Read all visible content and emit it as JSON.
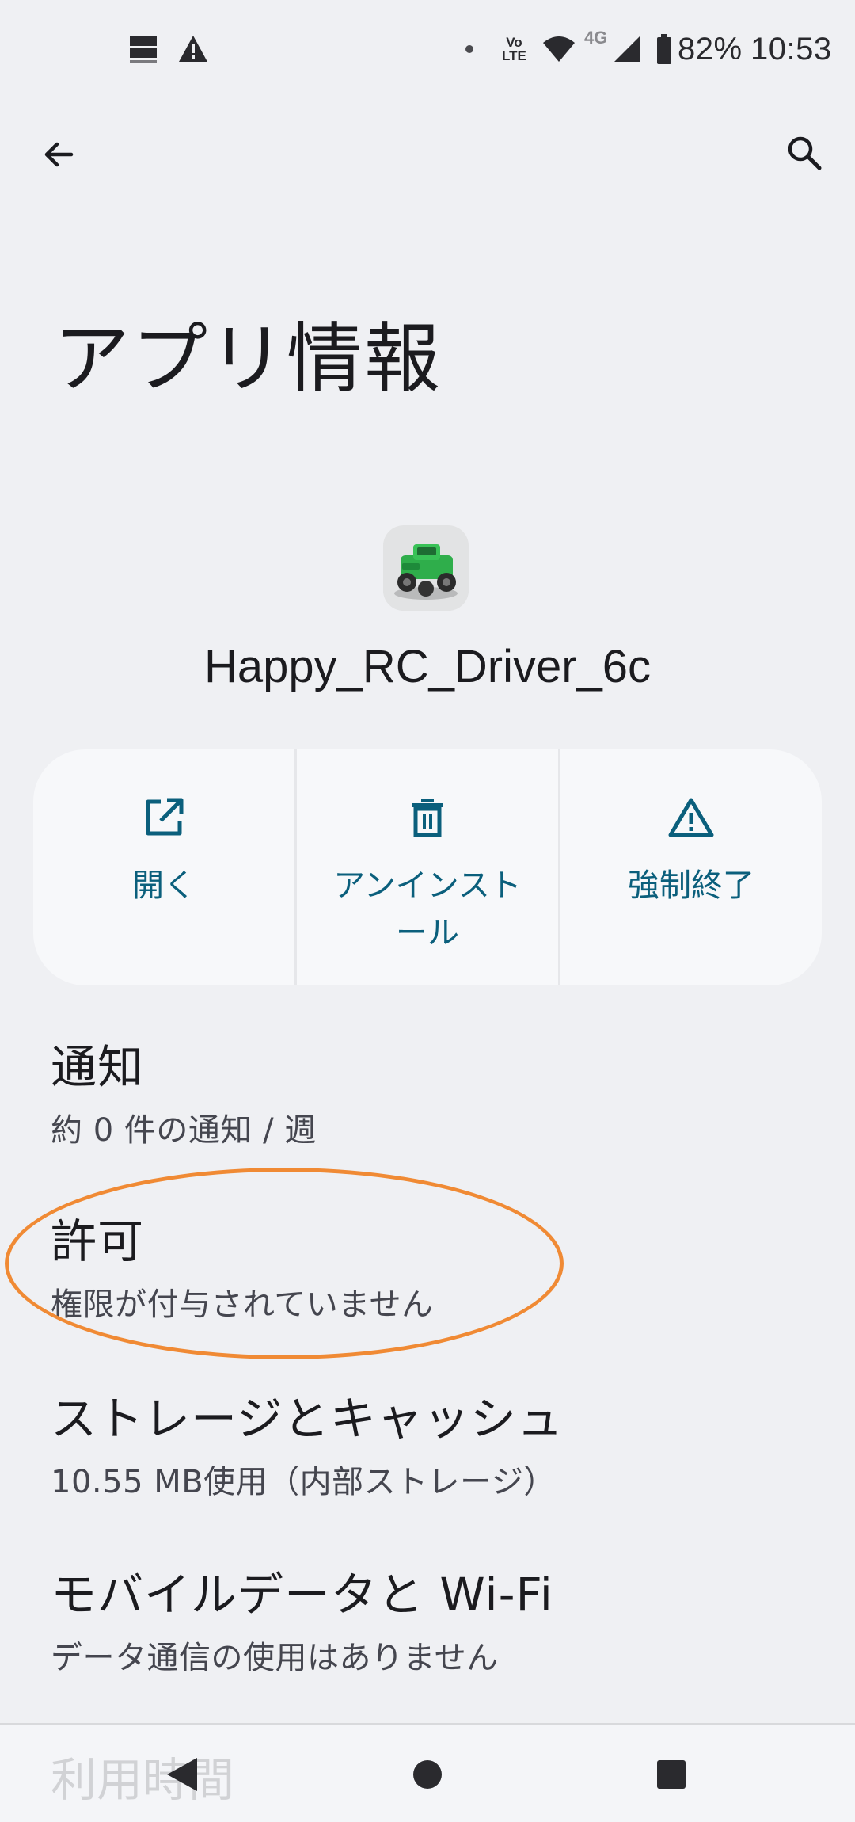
{
  "status_bar": {
    "lte_label_top": "Vo",
    "lte_label_bottom": "LTE",
    "network": "4G",
    "battery": "82%",
    "time": "10:53"
  },
  "top_bar": {
    "back_icon": "arrow-left-icon",
    "search_icon": "search-icon"
  },
  "page": {
    "title": "アプリ情報"
  },
  "app": {
    "name": "Happy_RC_Driver_6c",
    "icon": "green-rc-truck-icon"
  },
  "actions": [
    {
      "label": "開く",
      "icon": "open-external-icon"
    },
    {
      "label": "アンインストール",
      "icon": "trash-icon"
    },
    {
      "label": "強制終了",
      "icon": "warning-icon"
    }
  ],
  "settings": [
    {
      "title": "通知",
      "subtitle": "約 0 件の通知 / 週"
    },
    {
      "title": "許可",
      "subtitle": "権限が付与されていません"
    },
    {
      "title": "ストレージとキャッシュ",
      "subtitle": "10.55 MB使用（内部ストレージ）"
    },
    {
      "title": "モバイルデータと Wi-Fi",
      "subtitle": "データ通信の使用はありません"
    }
  ],
  "peek_item": {
    "title": "利用時間"
  },
  "nav": {
    "back": "nav-back-icon",
    "home": "nav-home-icon",
    "recents": "nav-recents-icon"
  },
  "colors": {
    "background": "#eff0f3",
    "card": "#f7f8fa",
    "accent": "#0b5f7c",
    "highlight": "#f08a34"
  }
}
